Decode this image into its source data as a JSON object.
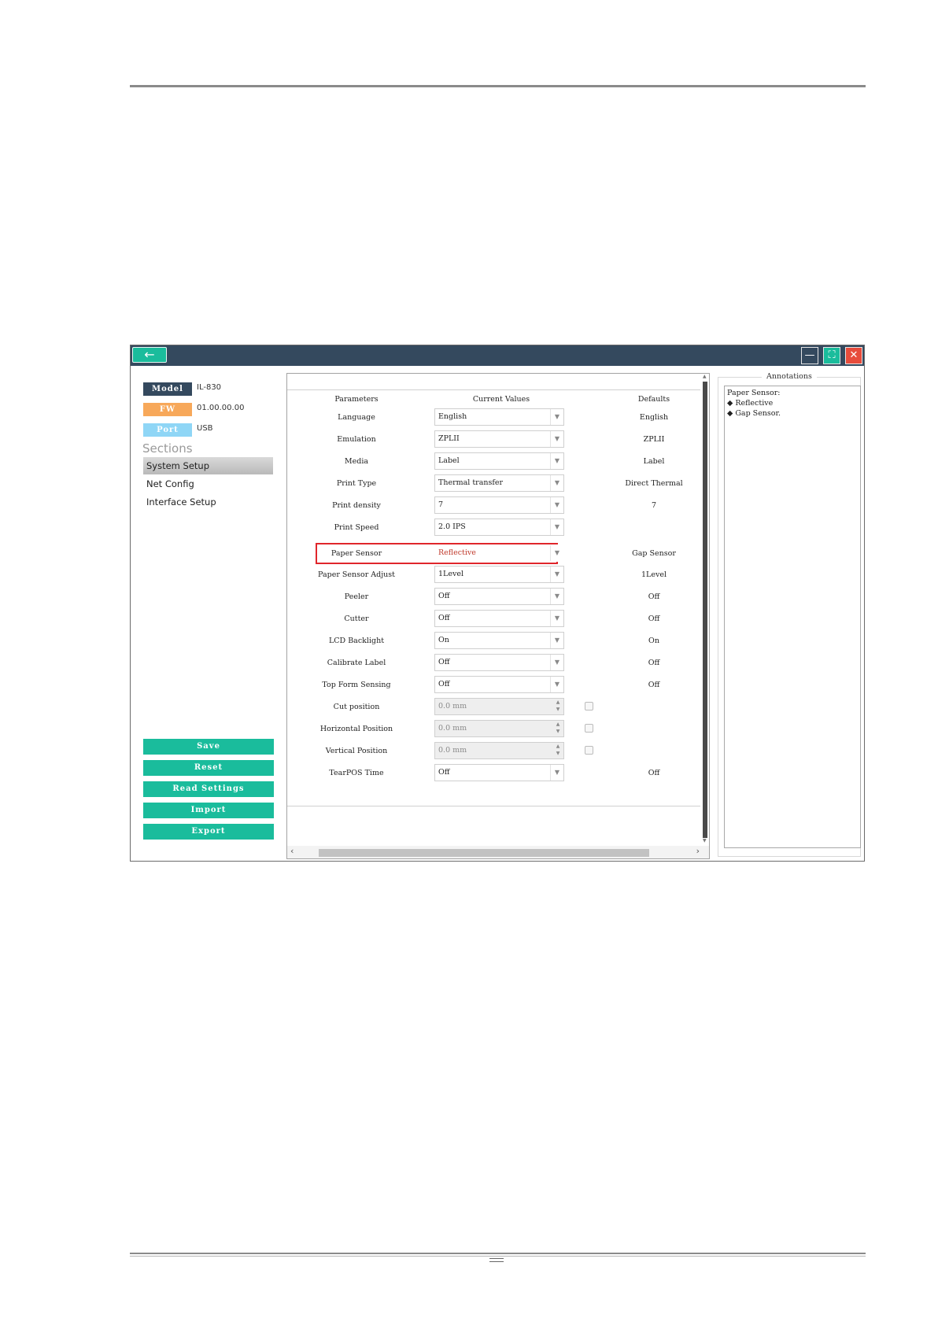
{
  "window": {
    "back_icon": "arrow-left-icon",
    "controls": {
      "minimize": "—",
      "maximize": "⛶",
      "close": "✕"
    }
  },
  "device": {
    "model_label": "Model",
    "model_value": "IL-830",
    "fw_label": "FW",
    "fw_value": "01.00.00.00",
    "port_label": "Port",
    "port_value": "USB"
  },
  "sections": {
    "title": "Sections",
    "items": [
      "System Setup",
      "Net Config",
      "Interface Setup"
    ]
  },
  "actions": {
    "save": "Save",
    "reset": "Reset",
    "read_settings": "Read Settings",
    "import": "Import",
    "export": "Export"
  },
  "table": {
    "headers": {
      "parameters": "Parameters",
      "current": "Current Values",
      "defaults": "Defaults"
    },
    "rows": [
      {
        "param": "Language",
        "value": "English",
        "default": "English"
      },
      {
        "param": "Emulation",
        "value": "ZPLII",
        "default": "ZPLII"
      },
      {
        "param": "Media",
        "value": "Label",
        "default": "Label"
      },
      {
        "param": "Print Type",
        "value": "Thermal transfer",
        "default": "Direct Thermal"
      },
      {
        "param": "Print density",
        "value": "7",
        "default": "7"
      },
      {
        "param": "Print Speed",
        "value": "2.0 IPS",
        "default": ""
      },
      {
        "param": "Paper Sensor",
        "value": "Reflective",
        "default": "Gap Sensor"
      },
      {
        "param": "Paper Sensor Adjust",
        "value": "1Level",
        "default": "1Level"
      },
      {
        "param": "Peeler",
        "value": "Off",
        "default": "Off"
      },
      {
        "param": "Cutter",
        "value": "Off",
        "default": "Off"
      },
      {
        "param": "LCD Backlight",
        "value": "On",
        "default": "On"
      },
      {
        "param": "Calibrate Label",
        "value": "Off",
        "default": "Off"
      },
      {
        "param": "Top Form Sensing",
        "value": "Off",
        "default": "Off"
      },
      {
        "param": "Cut position",
        "value": "0.0 mm",
        "default": ""
      },
      {
        "param": "Horizontal Position",
        "value": "0.0 mm",
        "default": ""
      },
      {
        "param": "Vertical Position",
        "value": "0.0 mm",
        "default": ""
      },
      {
        "param": "TearPOS Time",
        "value": "Off",
        "default": "Off"
      }
    ],
    "highlight_color": "#e0262b"
  },
  "annotations": {
    "title": "Annotations",
    "lines": [
      "Paper Sensor:",
      "◆ Reflective",
      "◆ Gap Sensor."
    ]
  },
  "colors": {
    "titlebar": "#34495e",
    "accent": "#1abc9c",
    "close": "#e74c3c",
    "fw_badge": "#f7a85a",
    "port_badge": "#8fd6f6"
  }
}
